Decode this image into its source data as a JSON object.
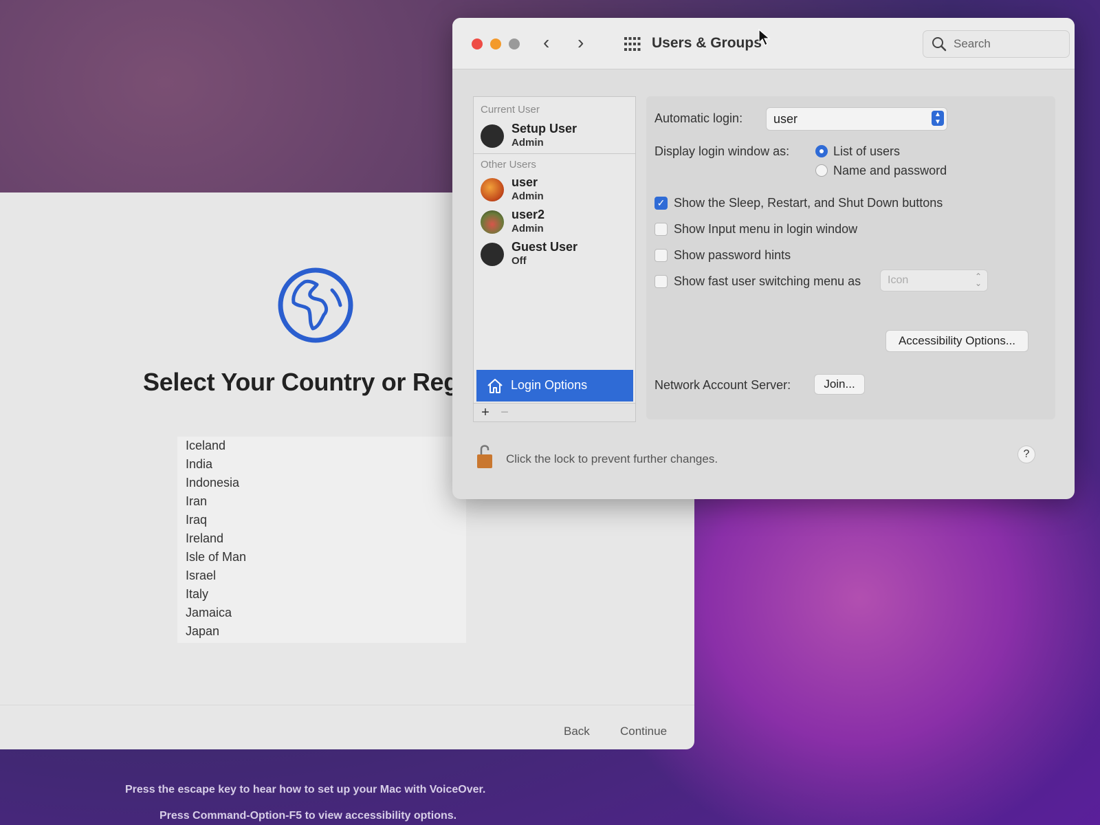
{
  "setup": {
    "title": "Select Your Country or Regi",
    "countries": [
      "Iceland",
      "India",
      "Indonesia",
      "Iran",
      "Iraq",
      "Ireland",
      "Isle of Man",
      "Israel",
      "Italy",
      "Jamaica",
      "Japan"
    ],
    "back_label": "Back",
    "continue_label": "Continue",
    "hint_voiceover": "Press the escape key to hear how to set up your Mac with VoiceOver.",
    "hint_accessibility": "Press Command-Option-F5 to view accessibility options."
  },
  "prefs": {
    "title": "Users & Groups",
    "search_placeholder": "Search",
    "current_user_label": "Current User",
    "other_users_label": "Other Users",
    "users": [
      {
        "name": "Setup User",
        "role": "Admin"
      },
      {
        "name": "user",
        "role": "Admin"
      },
      {
        "name": "user2",
        "role": "Admin"
      },
      {
        "name": "Guest User",
        "role": "Off"
      }
    ],
    "login_options_label": "Login Options",
    "add_label": "+",
    "remove_label": "−",
    "automatic_login_label": "Automatic login:",
    "automatic_login_value": "user",
    "display_login_label": "Display login window as:",
    "radio_list": "List of users",
    "radio_name_password": "Name and password",
    "show_sleep_label": "Show the Sleep, Restart, and Shut Down buttons",
    "show_input_label": "Show Input menu in login window",
    "show_hints_label": "Show password hints",
    "show_fast_label": "Show fast user switching menu as",
    "fast_value": "Icon",
    "accessibility_label": "Accessibility Options...",
    "network_label": "Network Account Server:",
    "join_label": "Join...",
    "lock_text": "Click the lock to prevent further changes.",
    "help_label": "?"
  },
  "colors": {
    "accent": "#2f6bd6",
    "close": "#ee4c45",
    "minimize": "#f39a2c",
    "zoom": "#9a9a9a"
  }
}
